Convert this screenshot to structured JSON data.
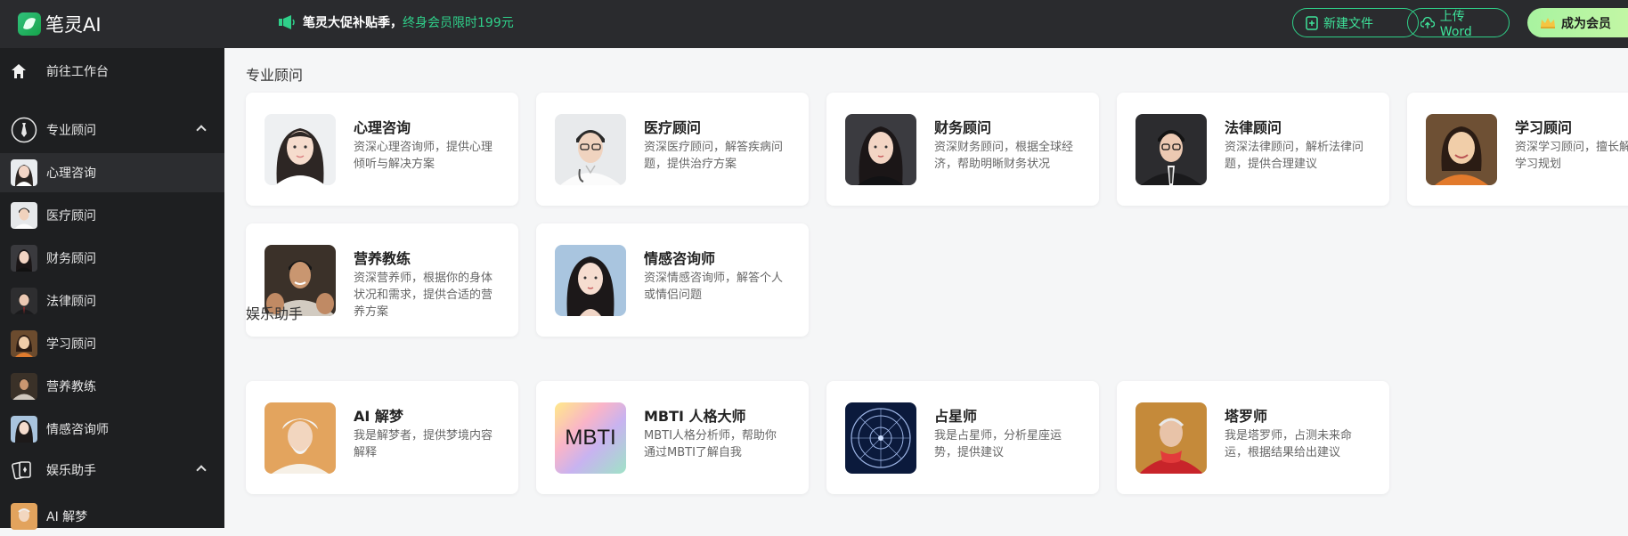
{
  "app": {
    "name": "笔灵AI"
  },
  "promo": {
    "bold": "笔灵大促补贴季，",
    "highlight": "终身会员限时199元"
  },
  "header_buttons": {
    "new_file": "新建文件",
    "upload_word": "上传Word",
    "vip": "成为会员"
  },
  "sidebar": {
    "workspace": "前往工作台",
    "groups": [
      {
        "label": "专业顾问",
        "items": [
          "心理咨询",
          "医疗顾问",
          "财务顾问",
          "法律顾问",
          "学习顾问",
          "营养教练",
          "情感咨询师"
        ]
      },
      {
        "label": "娱乐助手",
        "items": [
          "AI 解梦"
        ]
      }
    ],
    "active_item": "心理咨询"
  },
  "main": {
    "sections": [
      {
        "title": "专业顾问",
        "cards": [
          {
            "title": "心理咨询",
            "desc": "资深心理咨询师，提供心理倾听与解决方案"
          },
          {
            "title": "医疗顾问",
            "desc": "资深医疗顾问，解答疾病问题，提供治疗方案"
          },
          {
            "title": "财务顾问",
            "desc": "资深财务顾问，根据全球经济，帮助明晰财务状况"
          },
          {
            "title": "法律顾问",
            "desc": "资深法律顾问，解析法律问题，提供合理建议"
          },
          {
            "title": "学习顾问",
            "desc": "资深学习顾问，擅长解答和学习规划"
          },
          {
            "title": "营养教练",
            "desc": "资深营养师，根据你的身体状况和需求，提供合适的营养方案"
          },
          {
            "title": "情感咨询师",
            "desc": "资深情感咨询师，解答个人或情侣问题"
          }
        ]
      },
      {
        "title": "娱乐助手",
        "cards": [
          {
            "title": "AI 解梦",
            "desc": "我是解梦者，提供梦境内容解释"
          },
          {
            "title": "MBTI 人格大师",
            "desc": "MBTI人格分析师，帮助你通过MBTI了解自我",
            "logo_text": "MBTI"
          },
          {
            "title": "占星师",
            "desc": "我是占星师，分析星座运势，提供建议"
          },
          {
            "title": "塔罗师",
            "desc": "我是塔罗师，占测未来命运，根据结果给出建议"
          }
        ]
      }
    ]
  },
  "colors": {
    "accent": "#2fcf88",
    "topbar": "#2a2b2e",
    "sidebar": "#1e1f21",
    "vip_gradient": "#a8f3a0"
  }
}
